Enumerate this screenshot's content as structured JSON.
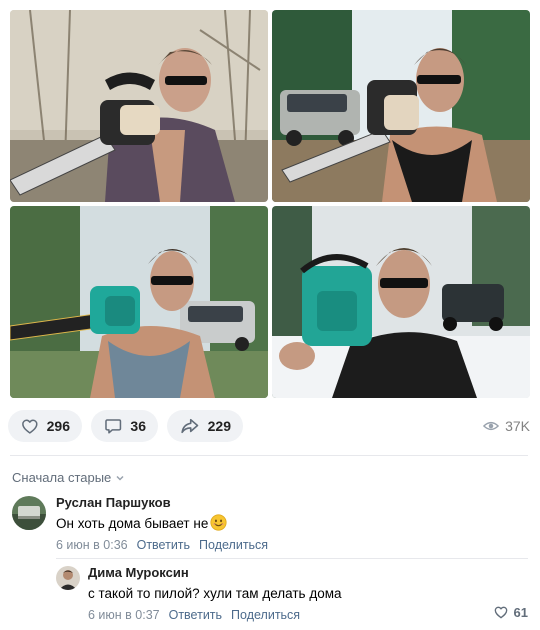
{
  "post": {
    "photos": [
      {
        "name": "photo-1"
      },
      {
        "name": "photo-2"
      },
      {
        "name": "photo-3"
      },
      {
        "name": "photo-4"
      }
    ],
    "actions": {
      "likes": "296",
      "comments": "36",
      "shares": "229",
      "views": "37K"
    },
    "icons": {
      "like": "heart-icon",
      "comment": "comment-icon",
      "share": "share-arrow-icon",
      "views": "eye-icon"
    }
  },
  "comments": {
    "sort_label": "Сначала старые",
    "items": [
      {
        "author": "Руслан Паршуков",
        "text": "Он хоть дома бывает не",
        "date": "6 июн в 0:36",
        "reply": "Ответить",
        "share": "Поделиться"
      },
      {
        "author": "Дима Муроксин",
        "text": "с такой то пилой? хули там делать дома",
        "date": "6 июн в 0:37",
        "reply": "Ответить",
        "share": "Поделиться",
        "likes": "61"
      }
    ]
  },
  "colors": {
    "accent": "#4d6b8c",
    "pill_bg": "#f0f2f5",
    "muted": "#818c99"
  }
}
